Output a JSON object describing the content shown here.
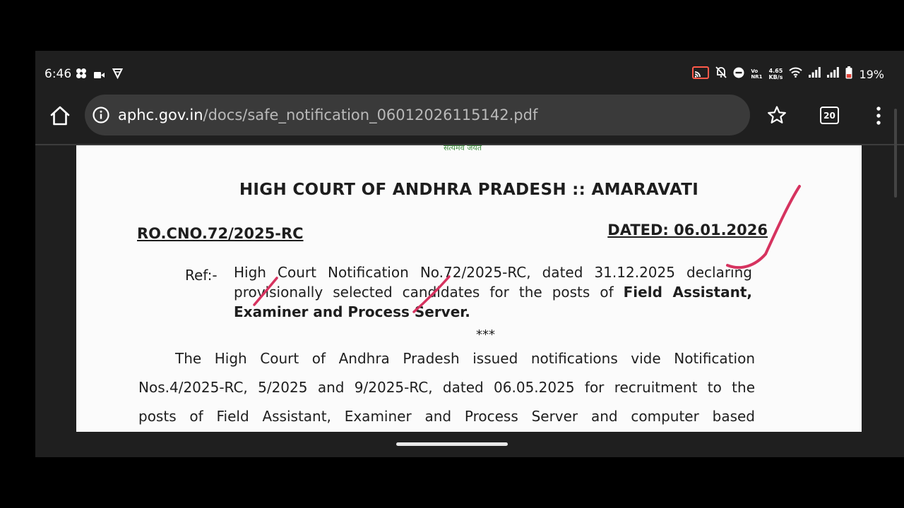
{
  "status_bar": {
    "time": "6:46",
    "volte_top": "Vo",
    "volte_bottom": "NR1",
    "net_speed_value": "4.65",
    "net_speed_unit": "KB/s",
    "battery_percent": "19%"
  },
  "browser": {
    "url_domain": "aphc.gov.in",
    "url_path": "/docs/safe_notification_06012026115142.pdf",
    "tab_count": "20"
  },
  "document": {
    "emblem_caption": "सत्यमेव जयते",
    "title": "HIGH COURT OF ANDHRA PRADESH :: AMARAVATI",
    "rc_number": "RO.CNO.72/2025-RC",
    "dated": "DATED: 06.01.2026",
    "ref_label": "Ref:-",
    "ref_line_1": "High Court Notification No.72/2025-RC, dated 31.12.2025 declaring",
    "ref_line_2_text": "provisionally selected candidates for the posts of",
    "ref_line_2_bold": "Field Assistant,",
    "ref_line_3": "Examiner and Process Server.",
    "separator": "***",
    "body_line_1": "The High Court of Andhra Pradesh issued notifications vide Notification",
    "body_line_2": "Nos.4/2025-RC, 5/2025 and 9/2025-RC, dated 06.05.2025 for recruitment to the",
    "body_line_3": "posts of Field Assistant, Examiner and Process Server and computer based"
  },
  "colors": {
    "screen_bg": "#1f1f1f",
    "url_bar_bg": "#3a3a3a",
    "pen_mark": "#d6335f",
    "page_bg": "#fbfbfb",
    "cast_icon": "#ff5a4a"
  }
}
